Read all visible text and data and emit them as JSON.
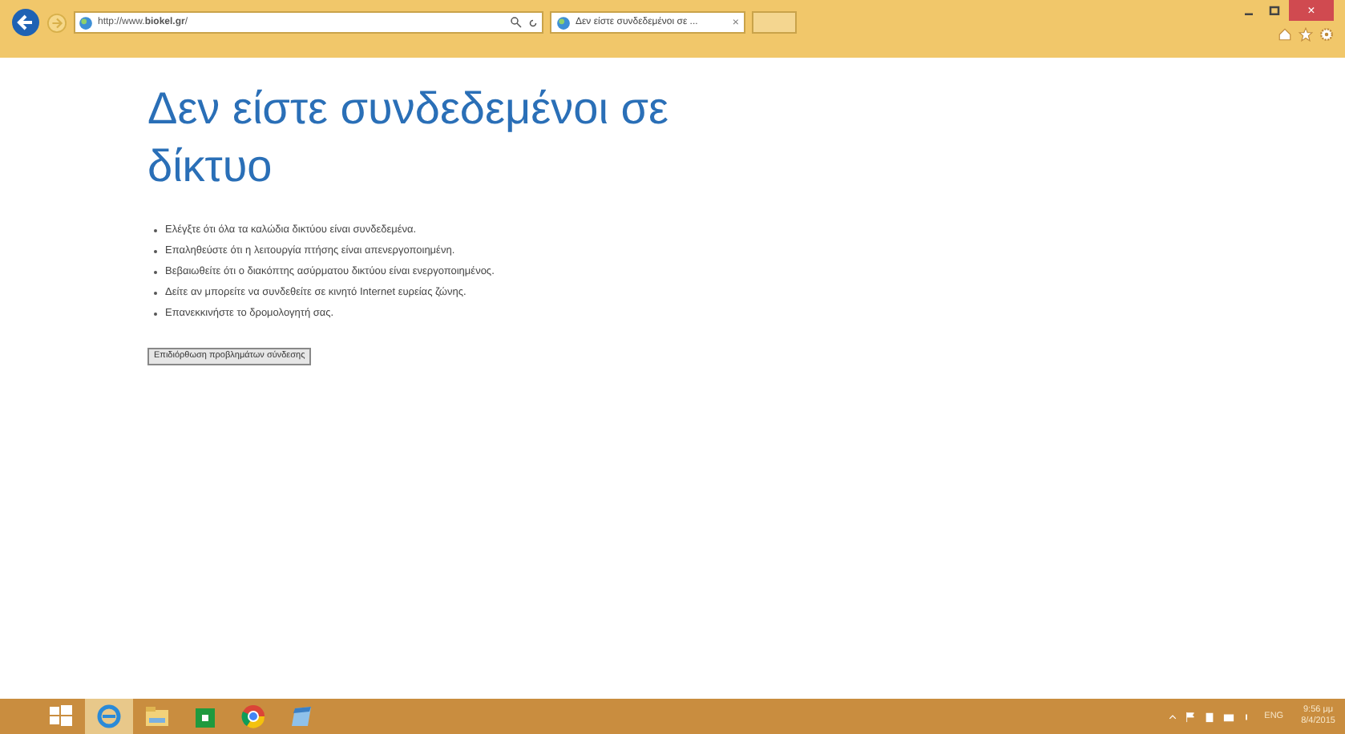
{
  "address_bar": {
    "url": "http://www.**biokel.gr**/"
  },
  "tabs": [
    {
      "title": "Δεν είστε συνδεδεμένοι σε ...",
      "selected": true,
      "close": "×"
    }
  ],
  "window_controls": {
    "close": "×"
  },
  "page": {
    "heading": "Δεν είστε συνδεδεμένοι σε δίκτυο",
    "tips": [
      "Ελέγξτε ότι όλα τα καλώδια δικτύου είναι συνδεδεμένα.",
      "Επαληθεύστε ότι η λειτουργία πτήσης είναι απενεργοποιημένη.",
      "Βεβαιωθείτε ότι ο διακόπτης ασύρματου δικτύου είναι ενεργοποιημένος.",
      "Δείτε αν μπορείτε να συνδεθείτε σε κινητό Internet ευρείας ζώνης.",
      "Επανεκκινήστε το δρομολογητή σας."
    ],
    "button": "Επιδιόρθωση προβλημάτων σύνδεσης"
  },
  "taskbar": {
    "apps": [
      {
        "kind": "start",
        "selected": false
      },
      {
        "kind": "ie",
        "selected": true
      },
      {
        "kind": "folder",
        "selected": false
      },
      {
        "kind": "store",
        "selected": false
      },
      {
        "kind": "chrome",
        "selected": false
      },
      {
        "kind": "notepad",
        "selected": false
      }
    ],
    "language": "ENG",
    "time": "9:56 μμ",
    "date": "8/4/2015"
  }
}
